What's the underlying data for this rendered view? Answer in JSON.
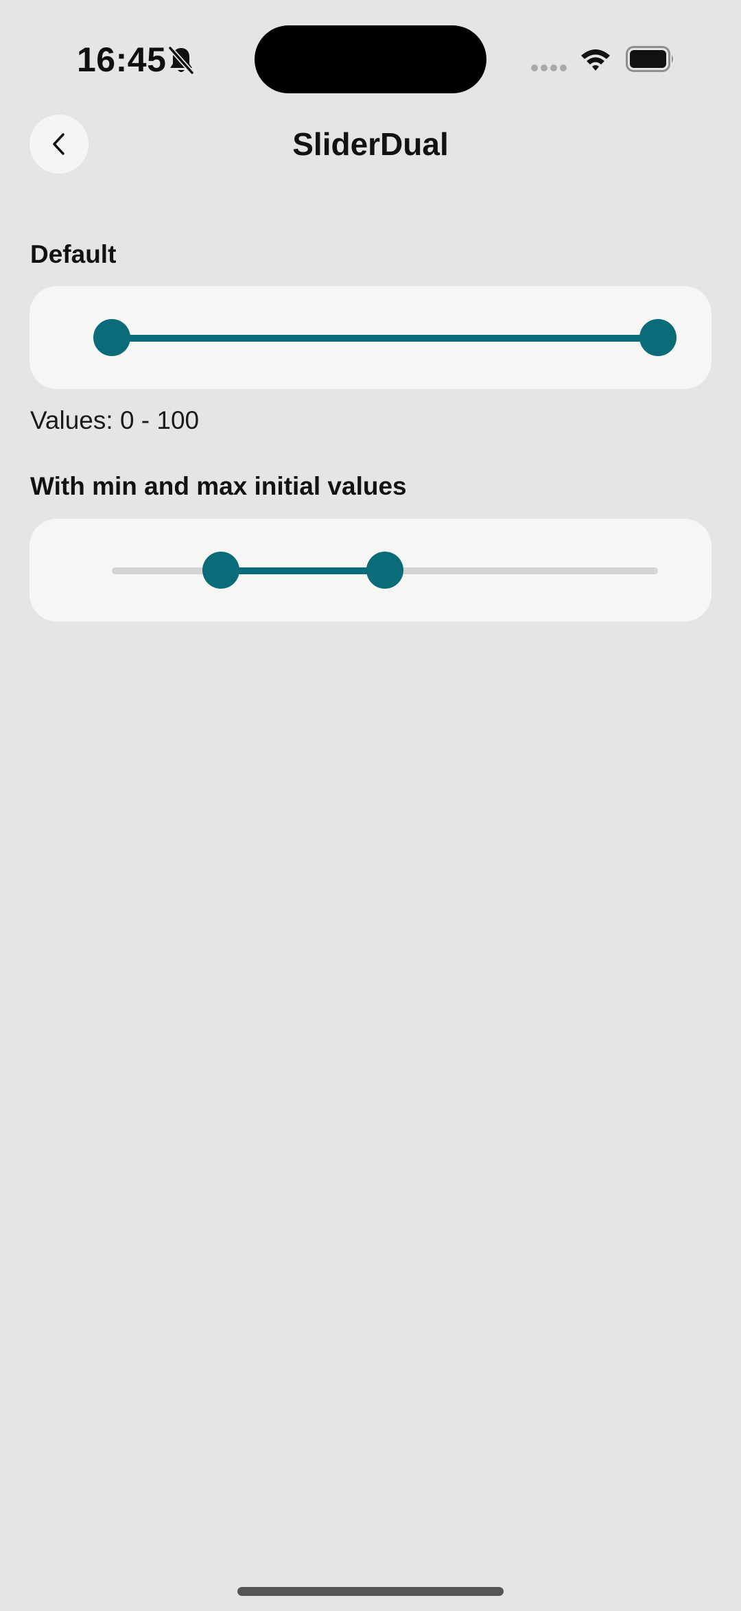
{
  "status_bar": {
    "time": "16:45",
    "icons": [
      "bell-off-icon",
      "signal-icon",
      "wifi-icon",
      "battery-icon"
    ]
  },
  "nav": {
    "title": "SliderDual",
    "back_icon": "chevron-left-icon"
  },
  "sections": [
    {
      "heading": "Default",
      "slider": {
        "min": 0,
        "max": 100,
        "low": 0,
        "high": 100
      },
      "values_text": "Values: 0 - 100"
    },
    {
      "heading": "With min and max initial values",
      "slider": {
        "min": 0,
        "max": 100,
        "low": 20,
        "high": 50
      }
    }
  ],
  "colors": {
    "background": "#E6E5E3",
    "card": "#F6F6F5",
    "accent": "#0A6B79",
    "track": "#D4D4D3"
  }
}
